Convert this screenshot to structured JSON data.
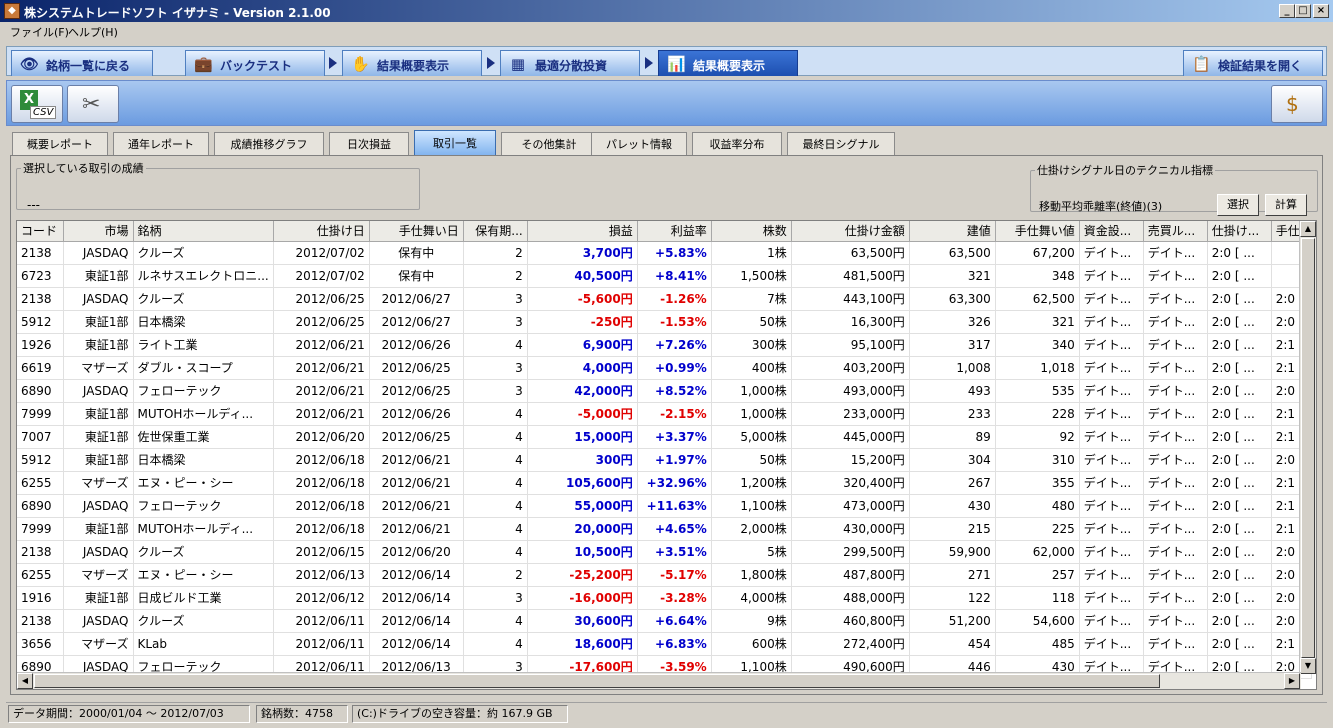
{
  "window": {
    "title": "株システムトレードソフト イザナミ - Version 2.1.00"
  },
  "menu": [
    "ファイル(F)",
    "ヘルプ(H)"
  ],
  "nav": {
    "back": "銘柄一覧に戻る",
    "backtest": "バックテスト",
    "summary": "結果概要表示",
    "optimal": "最適分散投資",
    "summary2": "結果概要表示",
    "open": "検証結果を開く"
  },
  "toolbar": {
    "csv_label": "CSV"
  },
  "subtabs": [
    "概要レポート",
    "通年レポート",
    "成績推移グラフ",
    "日次損益",
    "取引一覧",
    "その他集計",
    "パレット情報",
    "収益率分布",
    "最終日シグナル"
  ],
  "selected": {
    "legend": "選択している取引の成績",
    "value": "---"
  },
  "technical": {
    "legend": "仕掛けシグナル日のテクニカル指標",
    "label": "移動平均乖離率(終値)(3)",
    "select": "選択",
    "calc": "計算"
  },
  "table": {
    "columns": [
      "コード",
      "市場",
      "銘柄",
      "仕掛け日",
      "手仕舞い日",
      "保有期...",
      "損益",
      "利益率",
      "株数",
      "仕掛け金額",
      "建値",
      "手仕舞い値",
      "資金設...",
      "売買ル...",
      "仕掛け...",
      "手仕"
    ],
    "rows": [
      [
        "2138",
        "JASDAQ",
        "クルーズ",
        "2012/07/02",
        "保有中",
        "2",
        "3,700円",
        "+5.83%",
        "1株",
        "63,500円",
        "63,500",
        "67,200",
        "デイト...",
        "デイト...",
        "2:0 [ ...",
        ""
      ],
      [
        "6723",
        "東証1部",
        "ルネサスエレクトロニ...",
        "2012/07/02",
        "保有中",
        "2",
        "40,500円",
        "+8.41%",
        "1,500株",
        "481,500円",
        "321",
        "348",
        "デイト...",
        "デイト...",
        "2:0 [ ...",
        ""
      ],
      [
        "2138",
        "JASDAQ",
        "クルーズ",
        "2012/06/25",
        "2012/06/27",
        "3",
        "-5,600円",
        "-1.26%",
        "7株",
        "443,100円",
        "63,300",
        "62,500",
        "デイト...",
        "デイト...",
        "2:0 [ ...",
        "2:0"
      ],
      [
        "5912",
        "東証1部",
        "日本橋梁",
        "2012/06/25",
        "2012/06/27",
        "3",
        "-250円",
        "-1.53%",
        "50株",
        "16,300円",
        "326",
        "321",
        "デイト...",
        "デイト...",
        "2:0 [ ...",
        "2:0"
      ],
      [
        "1926",
        "東証1部",
        "ライト工業",
        "2012/06/21",
        "2012/06/26",
        "4",
        "6,900円",
        "+7.26%",
        "300株",
        "95,100円",
        "317",
        "340",
        "デイト...",
        "デイト...",
        "2:0 [ ...",
        "2:1"
      ],
      [
        "6619",
        "マザーズ",
        "ダブル・スコープ",
        "2012/06/21",
        "2012/06/25",
        "3",
        "4,000円",
        "+0.99%",
        "400株",
        "403,200円",
        "1,008",
        "1,018",
        "デイト...",
        "デイト...",
        "2:0 [ ...",
        "2:1"
      ],
      [
        "6890",
        "JASDAQ",
        "フェローテック",
        "2012/06/21",
        "2012/06/25",
        "3",
        "42,000円",
        "+8.52%",
        "1,000株",
        "493,000円",
        "493",
        "535",
        "デイト...",
        "デイト...",
        "2:0 [ ...",
        "2:0"
      ],
      [
        "7999",
        "東証1部",
        "MUTOHホールディ...",
        "2012/06/21",
        "2012/06/26",
        "4",
        "-5,000円",
        "-2.15%",
        "1,000株",
        "233,000円",
        "233",
        "228",
        "デイト...",
        "デイト...",
        "2:0 [ ...",
        "2:1"
      ],
      [
        "7007",
        "東証1部",
        "佐世保重工業",
        "2012/06/20",
        "2012/06/25",
        "4",
        "15,000円",
        "+3.37%",
        "5,000株",
        "445,000円",
        "89",
        "92",
        "デイト...",
        "デイト...",
        "2:0 [ ...",
        "2:1"
      ],
      [
        "5912",
        "東証1部",
        "日本橋梁",
        "2012/06/18",
        "2012/06/21",
        "4",
        "300円",
        "+1.97%",
        "50株",
        "15,200円",
        "304",
        "310",
        "デイト...",
        "デイト...",
        "2:0 [ ...",
        "2:0"
      ],
      [
        "6255",
        "マザーズ",
        "エヌ・ピー・シー",
        "2012/06/18",
        "2012/06/21",
        "4",
        "105,600円",
        "+32.96%",
        "1,200株",
        "320,400円",
        "267",
        "355",
        "デイト...",
        "デイト...",
        "2:0 [ ...",
        "2:1"
      ],
      [
        "6890",
        "JASDAQ",
        "フェローテック",
        "2012/06/18",
        "2012/06/21",
        "4",
        "55,000円",
        "+11.63%",
        "1,100株",
        "473,000円",
        "430",
        "480",
        "デイト...",
        "デイト...",
        "2:0 [ ...",
        "2:1"
      ],
      [
        "7999",
        "東証1部",
        "MUTOHホールディ...",
        "2012/06/18",
        "2012/06/21",
        "4",
        "20,000円",
        "+4.65%",
        "2,000株",
        "430,000円",
        "215",
        "225",
        "デイト...",
        "デイト...",
        "2:0 [ ...",
        "2:1"
      ],
      [
        "2138",
        "JASDAQ",
        "クルーズ",
        "2012/06/15",
        "2012/06/20",
        "4",
        "10,500円",
        "+3.51%",
        "5株",
        "299,500円",
        "59,900",
        "62,000",
        "デイト...",
        "デイト...",
        "2:0 [ ...",
        "2:0"
      ],
      [
        "6255",
        "マザーズ",
        "エヌ・ピー・シー",
        "2012/06/13",
        "2012/06/14",
        "2",
        "-25,200円",
        "-5.17%",
        "1,800株",
        "487,800円",
        "271",
        "257",
        "デイト...",
        "デイト...",
        "2:0 [ ...",
        "2:0"
      ],
      [
        "1916",
        "東証1部",
        "日成ビルド工業",
        "2012/06/12",
        "2012/06/14",
        "3",
        "-16,000円",
        "-3.28%",
        "4,000株",
        "488,000円",
        "122",
        "118",
        "デイト...",
        "デイト...",
        "2:0 [ ...",
        "2:0"
      ],
      [
        "2138",
        "JASDAQ",
        "クルーズ",
        "2012/06/11",
        "2012/06/14",
        "4",
        "30,600円",
        "+6.64%",
        "9株",
        "460,800円",
        "51,200",
        "54,600",
        "デイト...",
        "デイト...",
        "2:0 [ ...",
        "2:0"
      ],
      [
        "3656",
        "マザーズ",
        "KLab",
        "2012/06/11",
        "2012/06/14",
        "4",
        "18,600円",
        "+6.83%",
        "600株",
        "272,400円",
        "454",
        "485",
        "デイト...",
        "デイト...",
        "2:0 [ ...",
        "2:1"
      ],
      [
        "6890",
        "JASDAQ",
        "フェローテック",
        "2012/06/11",
        "2012/06/13",
        "3",
        "-17,600円",
        "-3.59%",
        "1,100株",
        "490,600円",
        "446",
        "430",
        "デイト...",
        "デイト...",
        "2:0 [ ...",
        "2:0"
      ]
    ]
  },
  "status": {
    "period": "データ期間：2000/01/04 〜 2012/07/03",
    "count": "銘柄数：4758",
    "disk": "(C:)ドライブの空き容量：約 167.9 GB"
  },
  "colors": {
    "positive": "#0000cc",
    "negative": "#e00000",
    "accent": "#1d4fb0"
  }
}
